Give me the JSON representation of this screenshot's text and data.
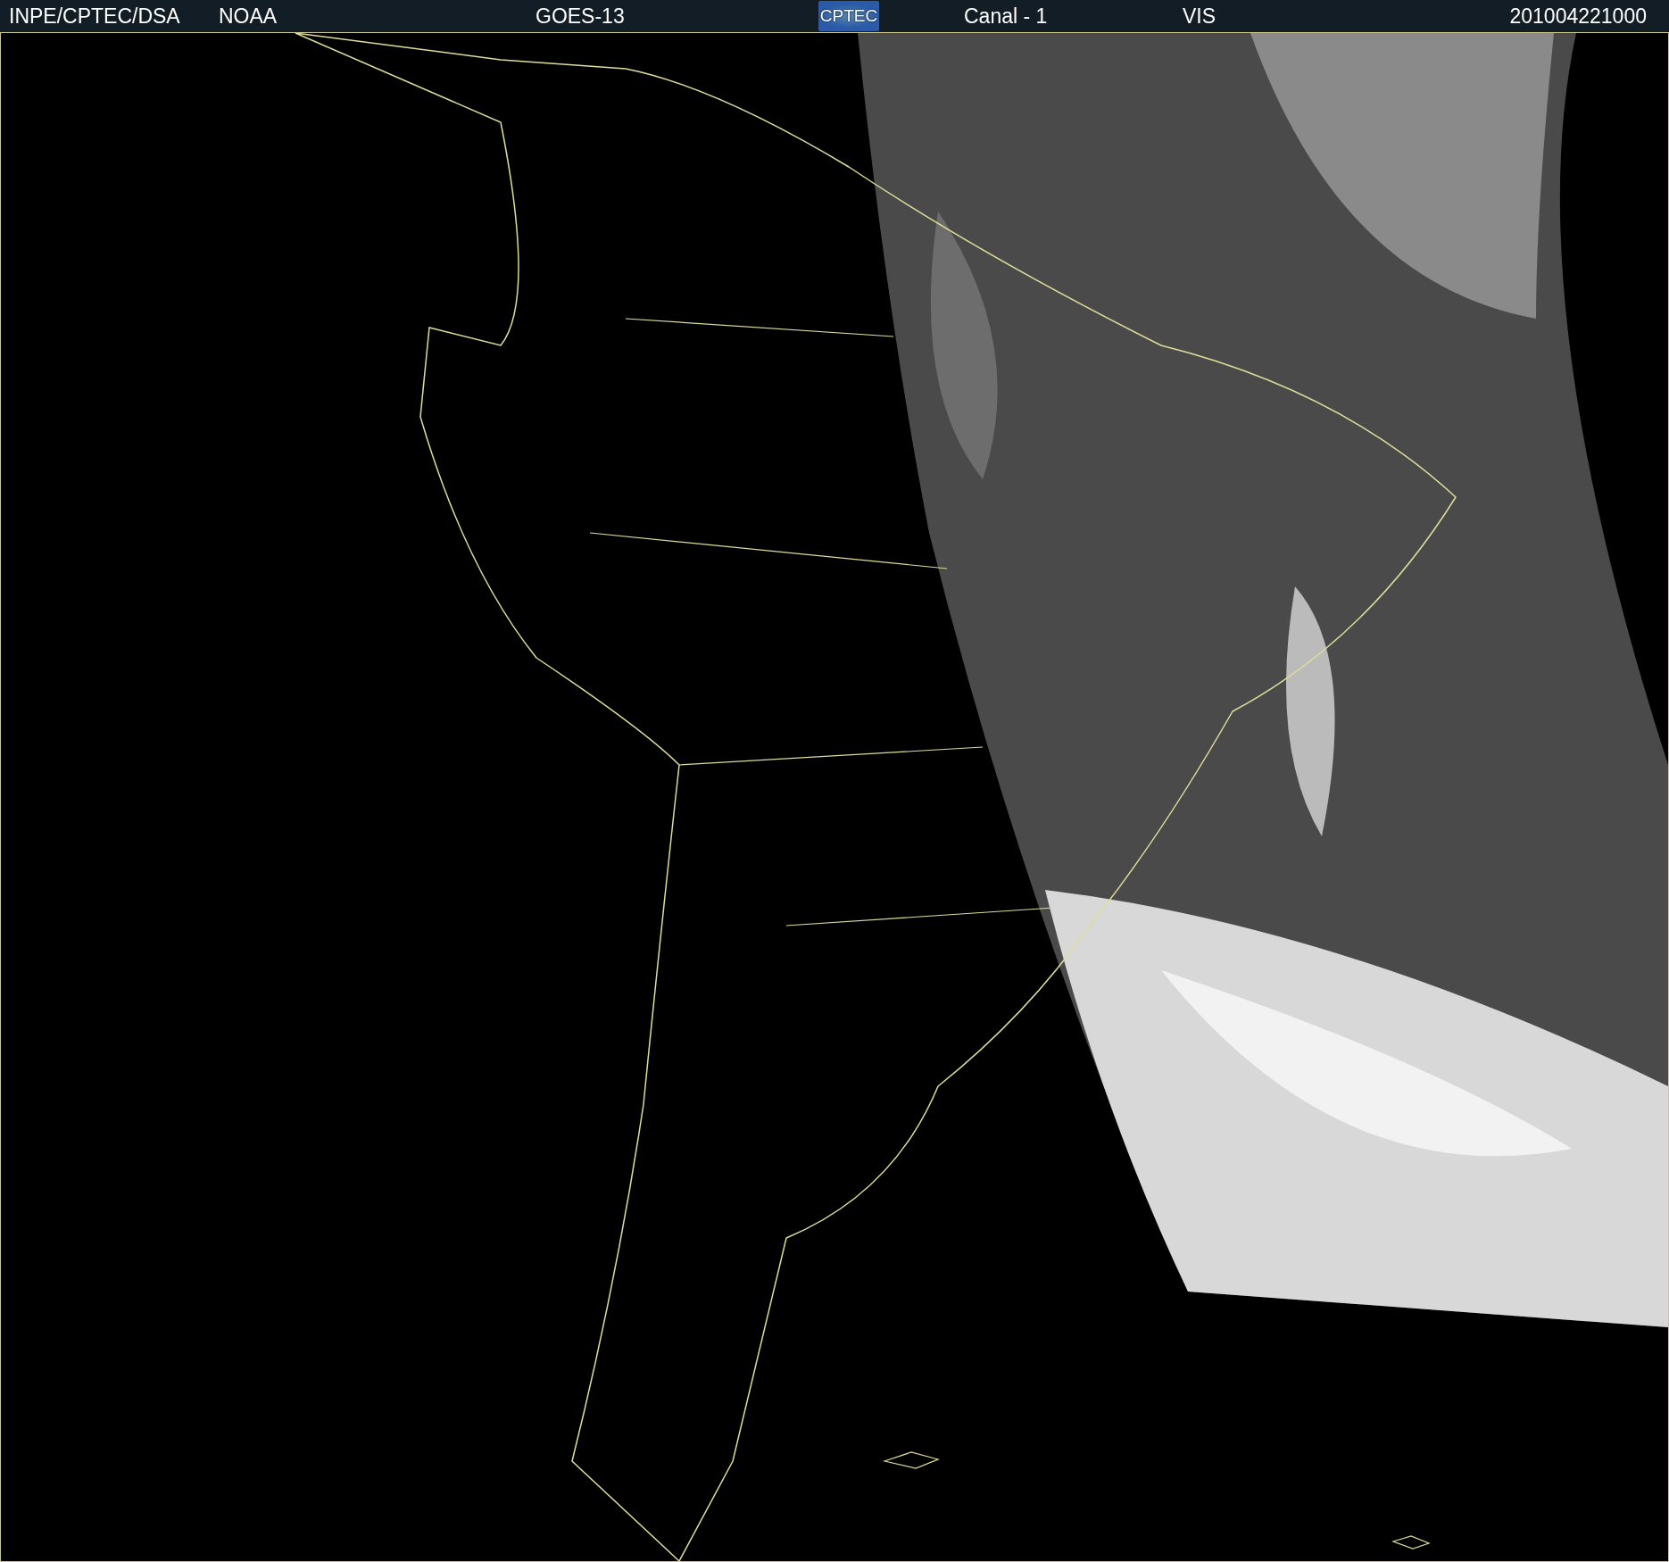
{
  "header": {
    "source": "INPE/CPTEC/DSA",
    "agency": "NOAA",
    "satellite": "GOES-13",
    "logo": "CPTEC",
    "channel": "Canal - 1",
    "band": "VIS",
    "timestamp": "201004221000"
  }
}
